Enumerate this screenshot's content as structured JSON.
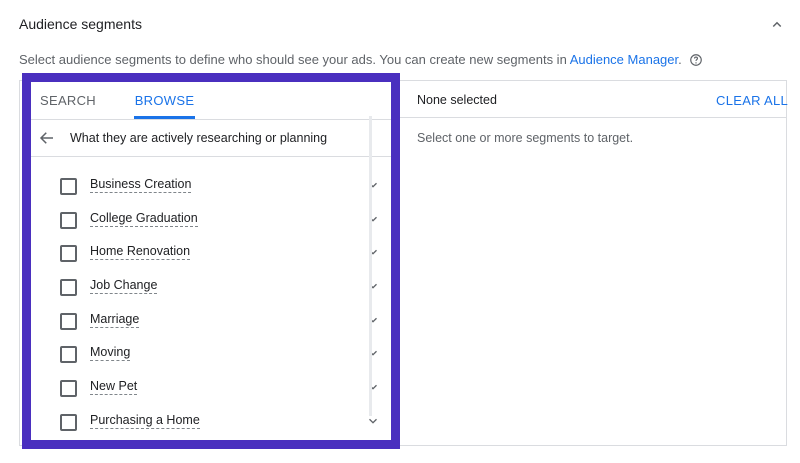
{
  "header": {
    "title": "Audience segments",
    "description_prefix": "Select audience segments to define who should see your ads. You can create new segments in ",
    "description_link": "Audience Manager",
    "description_suffix": "."
  },
  "tabs": [
    {
      "label": "SEARCH",
      "active": false
    },
    {
      "label": "BROWSE",
      "active": true
    }
  ],
  "browse": {
    "category": "What they are actively researching or planning",
    "items": [
      {
        "label": "Business Creation",
        "checked": false
      },
      {
        "label": "College Graduation",
        "checked": false
      },
      {
        "label": "Home Renovation",
        "checked": false
      },
      {
        "label": "Job Change",
        "checked": false
      },
      {
        "label": "Marriage",
        "checked": false
      },
      {
        "label": "Moving",
        "checked": false
      },
      {
        "label": "New Pet",
        "checked": false
      },
      {
        "label": "Purchasing a Home",
        "checked": false
      }
    ]
  },
  "selection": {
    "status": "None selected",
    "clear_label": "CLEAR ALL",
    "empty_message": "Select one or more segments to target."
  },
  "icons": {
    "collapse": "chevron-up-icon",
    "help": "help-circle-icon",
    "back": "arrow-back-icon",
    "expand": "chevron-down-icon"
  },
  "colors": {
    "accent": "#1a73e8",
    "highlight_border": "#4a2fbf",
    "text_primary": "#202124",
    "text_secondary": "#5f6368"
  }
}
